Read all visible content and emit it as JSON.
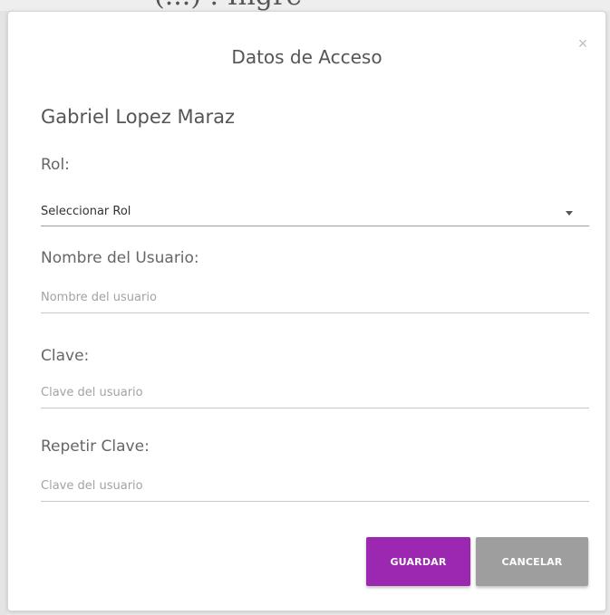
{
  "background_fragment": "(...) . Ingre",
  "dialog": {
    "title": "Datos de Acceso",
    "close_symbol": "×",
    "user_full_name": "Gabriel Lopez Maraz",
    "fields": {
      "role": {
        "label": "Rol:",
        "selected": "Seleccionar Rol"
      },
      "username": {
        "label": "Nombre del Usuario:",
        "value": "",
        "placeholder": "Nombre del usuario"
      },
      "password": {
        "label": "Clave:",
        "value": "",
        "placeholder": "Clave del usuario"
      },
      "password_repeat": {
        "label": "Repetir Clave:",
        "value": "",
        "placeholder": "Clave del usuario"
      }
    },
    "buttons": {
      "save": "GUARDAR",
      "cancel": "CANCELAR"
    }
  },
  "colors": {
    "accent": "#9c27b0",
    "cancel": "#9e9e9e",
    "text": "#555555"
  },
  "icons": {
    "close": "close-icon",
    "dropdown": "chevron-down-icon"
  }
}
